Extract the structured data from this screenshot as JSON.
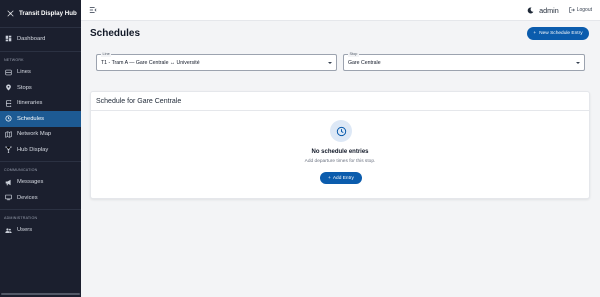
{
  "app": {
    "name": "Transit Display Hub"
  },
  "sidebar": {
    "sections": [
      {
        "label": "NETWORK"
      },
      {
        "label": "COMMUNICATION"
      },
      {
        "label": "ADMINISTRATION"
      }
    ],
    "items": [
      {
        "label": "Dashboard",
        "icon": "dashboard-icon"
      },
      {
        "label": "Lines",
        "icon": "lines-icon"
      },
      {
        "label": "Stops",
        "icon": "location-pin-icon"
      },
      {
        "label": "Itineraries",
        "icon": "itineraries-icon"
      },
      {
        "label": "Schedules",
        "icon": "clock-icon",
        "active": true
      },
      {
        "label": "Network Map",
        "icon": "map-icon"
      },
      {
        "label": "Hub Display",
        "icon": "hub-icon"
      },
      {
        "label": "Messages",
        "icon": "megaphone-icon"
      },
      {
        "label": "Devices",
        "icon": "monitor-icon"
      },
      {
        "label": "Users",
        "icon": "users-icon"
      }
    ]
  },
  "topbar": {
    "username": "admin",
    "logout_label": "Logout"
  },
  "page": {
    "title": "Schedules",
    "new_button_label": "New Schedule Entry"
  },
  "filters": {
    "line": {
      "label": "Line",
      "value": "T1 - Tram A — Gare Centrale ↔ Université"
    },
    "stop": {
      "label": "Stop",
      "value": "Gare Centrale"
    }
  },
  "schedule_card": {
    "title": "Schedule for Gare Centrale",
    "empty_title": "No schedule entries",
    "empty_subtitle": "Add departure times for this stop.",
    "add_button_label": "Add Entry"
  },
  "colors": {
    "sidebar_bg": "#1b1f2e",
    "active_item": "#1d5a93",
    "primary_button": "#0b5cad"
  }
}
